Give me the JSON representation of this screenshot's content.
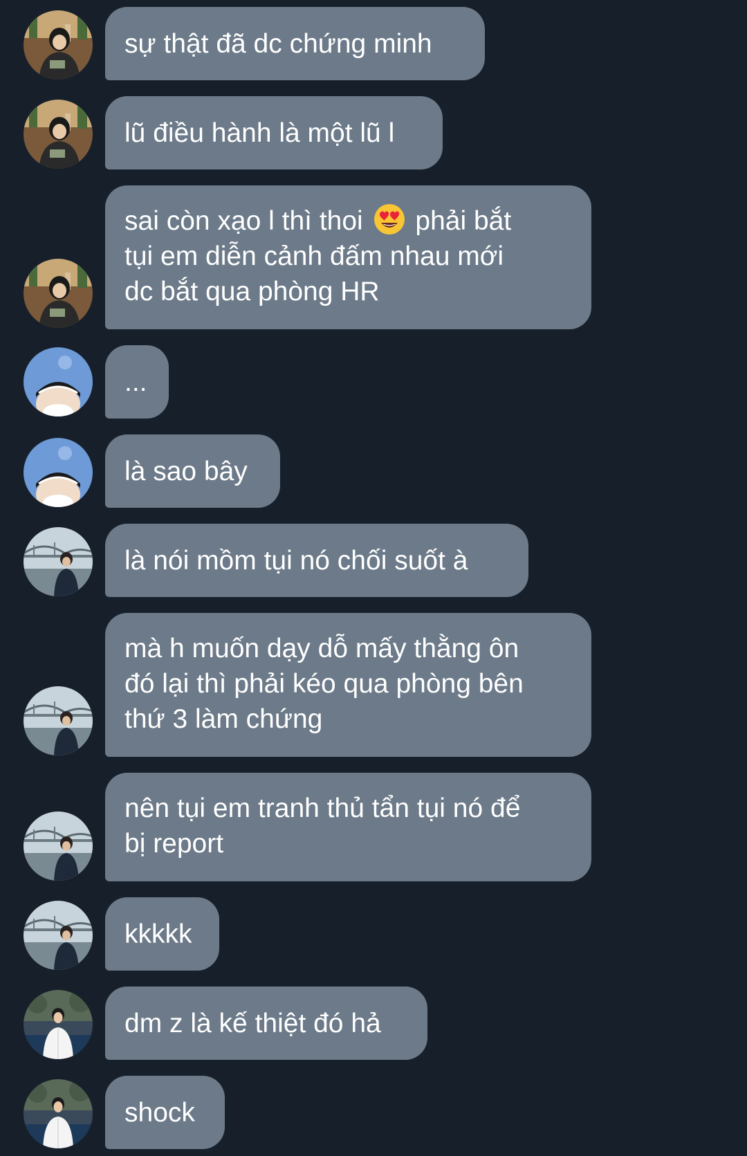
{
  "messages": [
    {
      "sender_avatar": "avatar-girl-cafe",
      "text": "sự thật đã dc chứng minh"
    },
    {
      "sender_avatar": "avatar-girl-cafe",
      "text": "lũ điều hành là một lũ l"
    },
    {
      "sender_avatar": "avatar-girl-cafe",
      "line1_before": "sai còn xạo l thì thoi",
      "emoji": "heart-eyes-emoji",
      "line1_after": "phải bắt",
      "line2": "tụi em diễn cảnh đấm nhau mới",
      "line3": "dc bắt qua phòng HR"
    },
    {
      "sender_avatar": "avatar-masked-sky",
      "text": "..."
    },
    {
      "sender_avatar": "avatar-masked-sky",
      "text": "là sao bây"
    },
    {
      "sender_avatar": "avatar-boy-bridge",
      "text": "là nói mồm tụi nó chối suốt à"
    },
    {
      "sender_avatar": "avatar-boy-bridge",
      "line1": "mà h muốn dạy dỗ mấy thằng ôn",
      "line2": "đó lại thì phải kéo qua phòng bên",
      "line3": "thứ 3 làm chứng"
    },
    {
      "sender_avatar": "avatar-boy-bridge",
      "line1": "nên tụi em tranh thủ tẩn tụi nó để",
      "line2": "bị report"
    },
    {
      "sender_avatar": "avatar-boy-bridge",
      "text": "kkkkk"
    },
    {
      "sender_avatar": "avatar-boy-white-shirt",
      "text": "dm z là kế thiệt đó hả"
    },
    {
      "sender_avatar": "avatar-boy-white-shirt",
      "text": "shock"
    }
  ],
  "colors": {
    "background": "#17202a",
    "bubble": "#6c7a89",
    "text": "#ffffff"
  }
}
